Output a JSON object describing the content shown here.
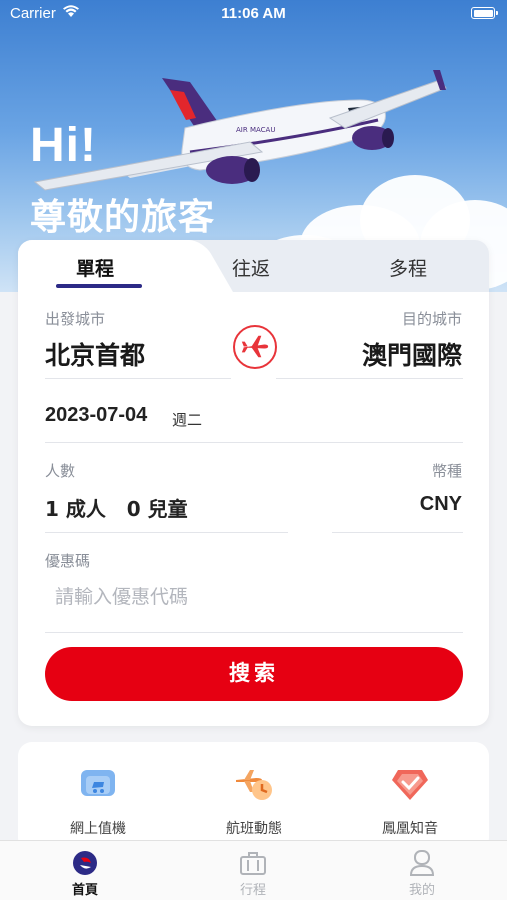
{
  "status_bar": {
    "carrier": "Carrier",
    "time": "11:06 AM"
  },
  "hero": {
    "greeting": "Hi!",
    "subtitle": "尊敬的旅客",
    "plane_livery": "AIR MACAU"
  },
  "booking": {
    "tabs": [
      {
        "label": "單程",
        "active": true
      },
      {
        "label": "往返",
        "active": false
      },
      {
        "label": "多程",
        "active": false
      }
    ],
    "origin": {
      "label": "出發城市",
      "value": "北京首都"
    },
    "destination": {
      "label": "目的城市",
      "value": "澳門國際"
    },
    "date": {
      "value": "2023-07-04",
      "weekday": "週二"
    },
    "passengers": {
      "label": "人數",
      "value": "1 成人   0 兒童"
    },
    "currency": {
      "label": "幣種",
      "value": "CNY"
    },
    "promo": {
      "label": "優惠碼",
      "placeholder": "請輸入優惠代碼",
      "value": ""
    },
    "search_button": "搜索",
    "accent_color": "#e60012"
  },
  "services": [
    {
      "label": "網上值機",
      "icon": "online-checkin-icon"
    },
    {
      "label": "航班動態",
      "icon": "flight-status-icon"
    },
    {
      "label": "鳳凰知音",
      "icon": "phoenix-miles-icon"
    }
  ],
  "tab_bar": [
    {
      "label": "首頁",
      "icon": "home-logo-icon",
      "active": true
    },
    {
      "label": "行程",
      "icon": "luggage-icon",
      "active": false
    },
    {
      "label": "我的",
      "icon": "profile-icon",
      "active": false
    }
  ]
}
